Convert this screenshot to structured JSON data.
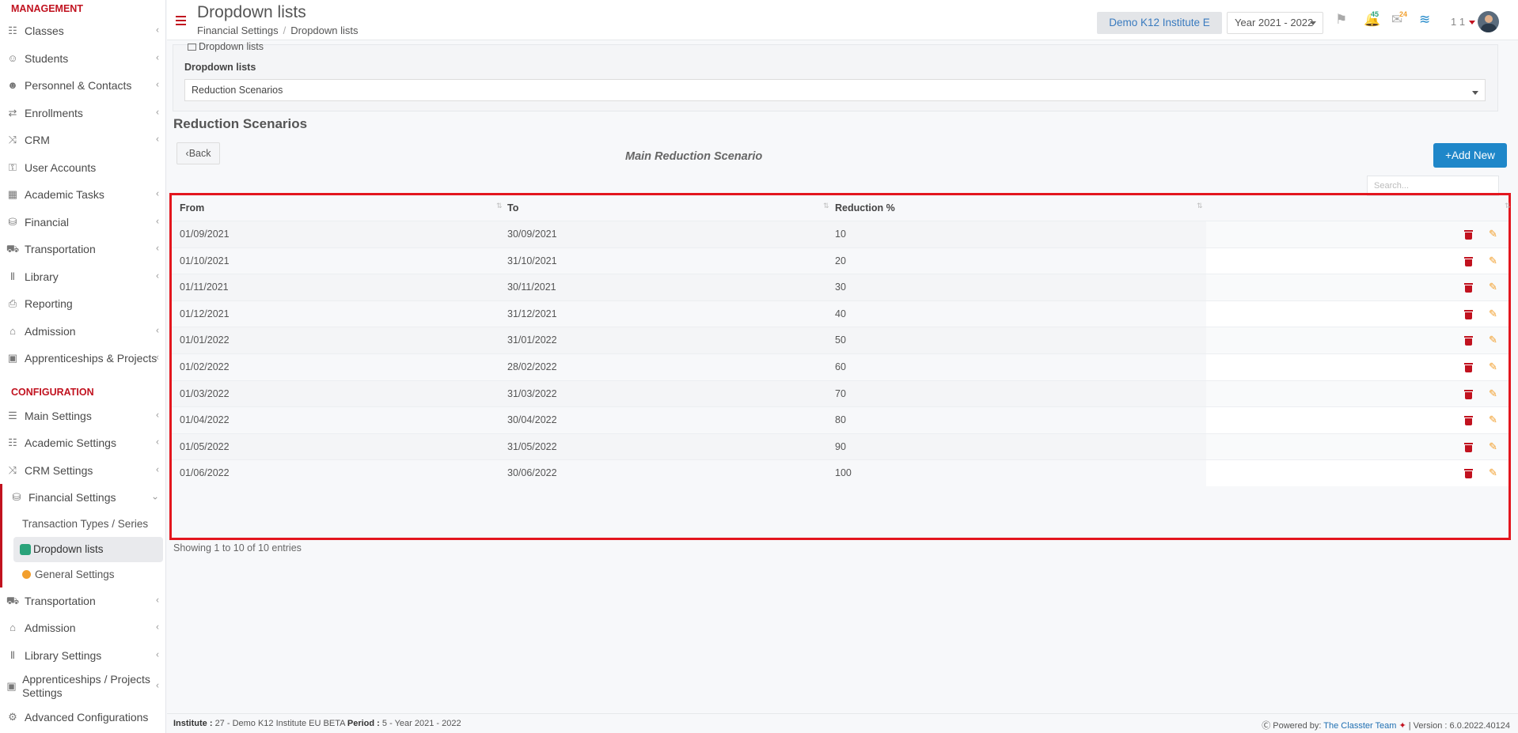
{
  "sidebar": {
    "management_title": "MANAGEMENT",
    "management_items": [
      {
        "label": "Classes",
        "icon": "classes-icon",
        "chevron": true
      },
      {
        "label": "Students",
        "icon": "students-icon",
        "chevron": true
      },
      {
        "label": "Personnel & Contacts",
        "icon": "personnel-icon",
        "chevron": true
      },
      {
        "label": "Enrollments",
        "icon": "enrollments-icon",
        "chevron": true
      },
      {
        "label": "CRM",
        "icon": "crm-icon",
        "chevron": true
      },
      {
        "label": "User Accounts",
        "icon": "key-icon",
        "chevron": false
      },
      {
        "label": "Academic Tasks",
        "icon": "tasks-icon",
        "chevron": true
      },
      {
        "label": "Financial",
        "icon": "coins-icon",
        "chevron": true
      },
      {
        "label": "Transportation",
        "icon": "bus-icon",
        "chevron": true
      },
      {
        "label": "Library",
        "icon": "books-icon",
        "chevron": true
      },
      {
        "label": "Reporting",
        "icon": "printer-icon",
        "chevron": false
      },
      {
        "label": "Admission",
        "icon": "bank-icon",
        "chevron": true
      },
      {
        "label": "Apprenticeships & Projects",
        "icon": "box-icon",
        "chevron": true
      }
    ],
    "configuration_title": "CONFIGURATION",
    "config_items_top": [
      {
        "label": "Main Settings",
        "icon": "sliders-icon",
        "chevron": true
      },
      {
        "label": "Academic Settings",
        "icon": "classes-icon",
        "chevron": true
      },
      {
        "label": "CRM Settings",
        "icon": "crm-icon",
        "chevron": true
      }
    ],
    "financial_settings": {
      "label": "Financial Settings",
      "icon": "coins-icon"
    },
    "financial_sub": [
      {
        "label": "Transaction Types / Series"
      },
      {
        "label": "Dropdown lists"
      },
      {
        "label": "General Settings"
      }
    ],
    "config_items_bottom": [
      {
        "label": "Transportation",
        "icon": "bus-icon",
        "chevron": true
      },
      {
        "label": "Admission",
        "icon": "bank-icon",
        "chevron": true
      },
      {
        "label": "Library Settings",
        "icon": "books-icon",
        "chevron": true
      },
      {
        "label": "Apprenticeships / Projects Settings",
        "icon": "box-icon",
        "chevron": true
      },
      {
        "label": "Advanced Configurations",
        "icon": "gears-icon",
        "chevron": false
      }
    ]
  },
  "header": {
    "title": "Dropdown lists",
    "breadcrumb": [
      "Financial Settings",
      "Dropdown lists"
    ],
    "institute": "Demo K12 Institute E",
    "year": "Year 2021 - 2022",
    "notifications_count": "45",
    "messages_count": "24",
    "user_number": "1 1"
  },
  "filter": {
    "tab_label": "Dropdown lists",
    "field_label": "Dropdown lists",
    "selected_value": "Reduction Scenarios"
  },
  "section_title": "Reduction Scenarios",
  "back_label": "Back",
  "scenario_title": "Main Reduction Scenario",
  "add_new_label": "Add New",
  "search_placeholder": "Search...",
  "table": {
    "columns": [
      "From",
      "To",
      "Reduction %"
    ],
    "rows": [
      {
        "from": "01/09/2021",
        "to": "30/09/2021",
        "reduction": "10"
      },
      {
        "from": "01/10/2021",
        "to": "31/10/2021",
        "reduction": "20"
      },
      {
        "from": "01/11/2021",
        "to": "30/11/2021",
        "reduction": "30"
      },
      {
        "from": "01/12/2021",
        "to": "31/12/2021",
        "reduction": "40"
      },
      {
        "from": "01/01/2022",
        "to": "31/01/2022",
        "reduction": "50"
      },
      {
        "from": "01/02/2022",
        "to": "28/02/2022",
        "reduction": "60"
      },
      {
        "from": "01/03/2022",
        "to": "31/03/2022",
        "reduction": "70"
      },
      {
        "from": "01/04/2022",
        "to": "30/04/2022",
        "reduction": "80"
      },
      {
        "from": "01/05/2022",
        "to": "31/05/2022",
        "reduction": "90"
      },
      {
        "from": "01/06/2022",
        "to": "30/06/2022",
        "reduction": "100"
      }
    ]
  },
  "entries_info": "Showing 1 to 10 of 10 entries",
  "footer": {
    "institute_label": "Institute :",
    "institute_value": "27 - Demo K12 Institute EU BETA",
    "period_label": "Period :",
    "period_value": "5 - Year 2021 - 2022",
    "powered_by": "Powered by:",
    "team": "The Classter Team",
    "version": "| Version : 6.0.2022.40124"
  },
  "colors": {
    "accent_red": "#c1121f",
    "primary_blue": "#1f87c9",
    "highlight_frame": "#e3161e",
    "edit_orange": "#f29f2d"
  }
}
